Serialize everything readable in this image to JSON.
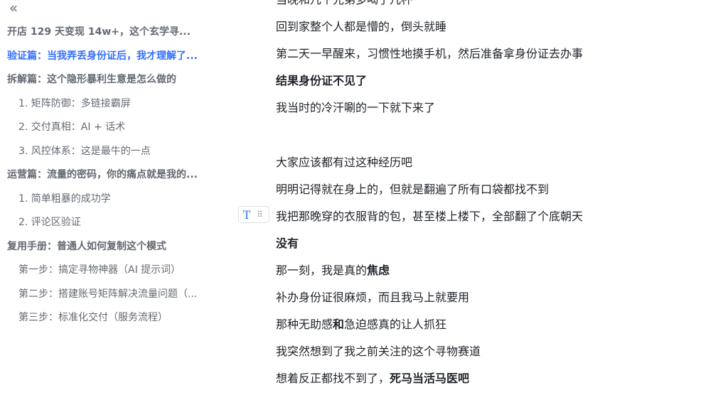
{
  "toc": {
    "collapse_glyph": "«",
    "items": [
      {
        "level": 1,
        "label": "开店 129 天变现 14w+，这个玄学寻...",
        "active": false
      },
      {
        "level": 1,
        "label": "验证篇：当我弄丢身份证后，我才理解了...",
        "active": true
      },
      {
        "level": 1,
        "label": "拆解篇：这个隐形暴利生意是怎么做的",
        "active": false
      },
      {
        "level": 2,
        "label": "1. 矩阵防御：多链接霸屏",
        "active": false
      },
      {
        "level": 2,
        "label": "2. 交付真相：AI + 话术",
        "active": false
      },
      {
        "level": 2,
        "label": "3. 风控体系：这是最牛的一点",
        "active": false
      },
      {
        "level": 1,
        "label": "运营篇：流量的密码，你的痛点就是我的...",
        "active": false
      },
      {
        "level": 2,
        "label": "1. 简单粗暴的成功学",
        "active": false
      },
      {
        "level": 2,
        "label": "2. 评论区验证",
        "active": false
      },
      {
        "level": 1,
        "label": "复用手册：普通人如何复制这个模式",
        "active": false
      },
      {
        "level": 2,
        "label": "第一步：搞定寻物神器（AI 提示词）",
        "active": false
      },
      {
        "level": 2,
        "label": "第二步：搭建账号矩阵解决流量问题（...",
        "active": false
      },
      {
        "level": 2,
        "label": "第三步：标准化交付（服务流程）",
        "active": false
      }
    ]
  },
  "block_handle": {
    "t_glyph": "T",
    "drag_glyph": "⠿"
  },
  "doc": {
    "paragraphs": [
      {
        "segments": [
          {
            "text": "当晚和几个兄弟多喝了几杯",
            "bold": false
          }
        ]
      },
      {
        "segments": [
          {
            "text": "回到家整个人都是懵的，倒头就睡",
            "bold": false
          }
        ]
      },
      {
        "segments": [
          {
            "text": "第二天一早醒来，习惯性地摸手机，然后准备拿身份证去办事",
            "bold": false
          }
        ]
      },
      {
        "segments": [
          {
            "text": "结果身份证不见了",
            "bold": true
          }
        ]
      },
      {
        "segments": [
          {
            "text": "我当时的冷汗唰的一下就下来了",
            "bold": false
          }
        ]
      },
      {
        "segments": []
      },
      {
        "segments": [
          {
            "text": "大家应该都有过这种经历吧",
            "bold": false
          }
        ]
      },
      {
        "segments": [
          {
            "text": "明明记得就在身上的，但就是翻遍了所有口袋都找不到",
            "bold": false
          }
        ]
      },
      {
        "segments": [
          {
            "text": "我把那晚穿的衣服背的包，甚至楼上楼下，全部翻了个底朝天",
            "bold": false
          }
        ]
      },
      {
        "segments": [
          {
            "text": "没有",
            "bold": true
          }
        ]
      },
      {
        "segments": [
          {
            "text": "那一刻，我是真的",
            "bold": false
          },
          {
            "text": "焦虑",
            "bold": true
          }
        ]
      },
      {
        "segments": [
          {
            "text": "补办身份证很麻烦，而且我马上就要用",
            "bold": false
          }
        ]
      },
      {
        "segments": [
          {
            "text": "那种无助感",
            "bold": false
          },
          {
            "text": "和",
            "bold": true
          },
          {
            "text": "急迫感真的让人抓狂",
            "bold": false
          }
        ]
      },
      {
        "segments": [
          {
            "text": "我突然想到了我之前关注的这个寻物赛道",
            "bold": false
          }
        ]
      },
      {
        "segments": [
          {
            "text": "想着反正都找不到了，",
            "bold": false
          },
          {
            "text": "死马当活马医吧",
            "bold": true
          }
        ]
      }
    ]
  }
}
